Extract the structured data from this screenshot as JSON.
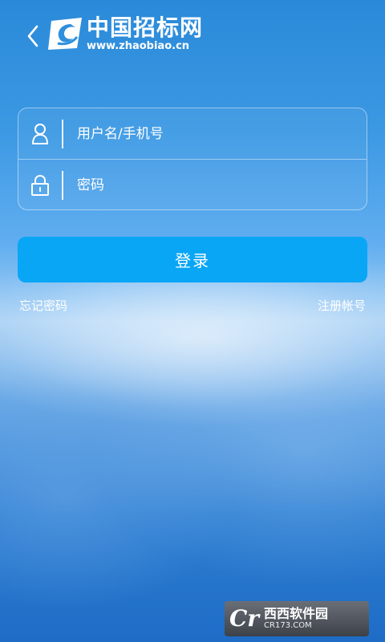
{
  "header": {
    "logo_cn": "中国招标网",
    "logo_url": "www.zhaobiao.cn"
  },
  "form": {
    "username_placeholder": "用户名/手机号",
    "password_placeholder": "密码"
  },
  "actions": {
    "login_label": "登录",
    "forgot_password": "忘记密码",
    "register": "注册帐号"
  },
  "watermark": {
    "logo": "Cr",
    "name": "西西软件园",
    "url": "CR173.COM"
  },
  "colors": {
    "accent": "#0aa6f6",
    "background_top": "#2a8ad9",
    "background_bottom": "#1e6cc6",
    "text": "#ffffff"
  },
  "icons": {
    "back": "chevron-left-icon",
    "username": "user-icon",
    "password": "lock-icon",
    "brand": "zhaobiao-logo-icon"
  }
}
